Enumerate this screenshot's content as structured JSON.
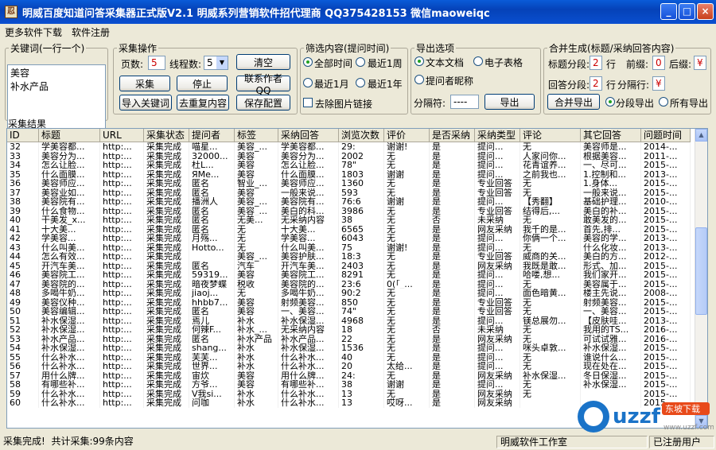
{
  "window": {
    "title": "明威百度知道问答采集器正式版V2.1 明威系列营销软件招代理商 QQ375428153 微信maoweiqc",
    "minimize": "_",
    "maximize": "□",
    "close": "×"
  },
  "menu": [
    "更多软件下载",
    "软件注册"
  ],
  "keywords": {
    "legend": "关键词(一行一个)",
    "lines": [
      "美容",
      "补水产品"
    ]
  },
  "collect": {
    "legend": "采集操作",
    "pages_label": "页数:",
    "pages_value": "5",
    "threads_label": "线程数:",
    "threads_value": "5",
    "clear": "清空",
    "collect": "采集",
    "stop": "停止",
    "contact": "联系作者QQ",
    "import": "导入关键词",
    "dedupe": "去重复内容",
    "save_config": "保存配置"
  },
  "filter": {
    "legend": "筛选内容(提问时间)",
    "all": "全部时间",
    "week": "最近1周",
    "month": "最近1月",
    "year": "最近1年",
    "remove_img": "去除图片链接"
  },
  "export": {
    "legend": "导出选项",
    "txt": "文本文档",
    "xls": "电子表格",
    "asker": "提问者昵称",
    "sep_label": "分隔符:",
    "sep_value": "----",
    "export_btn": "导出"
  },
  "merge": {
    "legend": "合并生成(标题/采纳回答内容)",
    "title_seg": "标题分段:",
    "title_seg_val": "2",
    "title_unit": "行",
    "prefix": "前缀:",
    "prefix_val": "0",
    "suffix": "后缀:",
    "suffix_val": "¥",
    "ans_seg": "回答分段:",
    "ans_seg_val": "2",
    "ans_unit": "行",
    "sepline": "分隔行:",
    "sepline_val": "¥",
    "merge_btn": "合并导出",
    "seg_export": "分段导出",
    "all_export": "所有导出"
  },
  "results": {
    "legend": "采集结果",
    "columns": [
      "ID",
      "标题",
      "URL",
      "采集状态",
      "提问者",
      "标签",
      "采纳回答",
      "浏览次数",
      "评价",
      "是否采纳",
      "采纳类型",
      "评论",
      "其它回答",
      "问题时间"
    ],
    "rows": [
      [
        "32",
        "学美容都...",
        "http:...",
        "采集完成",
        "喵星...",
        "美容_...",
        "学美容都...",
        "29:",
        "谢谢!",
        "是",
        "提问...",
        "无",
        "美容师是...",
        "2014-..."
      ],
      [
        "33",
        "美容分为...",
        "http:...",
        "采集完成",
        "32000...",
        "美容",
        "美容分为...",
        "2002",
        "无",
        "是",
        "提问...",
        "人家问你...",
        "根据美容...",
        "2011-..."
      ],
      [
        "34",
        "怎么让脸...",
        "http:...",
        "采集完成",
        "杜L...",
        "美容",
        "怎么让脸...",
        "78\"",
        "无",
        "是",
        "提问...",
        "花青谊养...",
        "一、尽可...",
        "2015-..."
      ],
      [
        "35",
        "什么面膜...",
        "http:...",
        "采集完成",
        "ЯMe...",
        "美容",
        "什么面膜...",
        "1803",
        "谢谢",
        "是",
        "提问...",
        "之前我也...",
        "1.控制和...",
        "2013-..."
      ],
      [
        "36",
        "美容师应...",
        "http:...",
        "采集完成",
        "匿名",
        "智业_...",
        "美容师应...",
        "1360",
        "无",
        "是",
        "专业回答",
        "无",
        "1.身体...",
        "2015-..."
      ],
      [
        "37",
        "美容业如...",
        "http:...",
        "采集完成",
        "匿名",
        "美容",
        "一般来说...",
        "593",
        "无",
        "是",
        "专业回答",
        "无",
        "一般来说...",
        "2015-..."
      ],
      [
        "38",
        "美容院有...",
        "http:...",
        "采集完成",
        "播洲人",
        "美容_...",
        "美容院有...",
        "76:6",
        "谢谢",
        "是",
        "提问...",
        "【秀翻】",
        "基础护理...",
        "2010-..."
      ],
      [
        "39",
        "什么食物...",
        "http:...",
        "采集完成",
        "匿名",
        "美容_...",
        "美白的科...",
        "3986",
        "无",
        "是",
        "专业回答",
        "结得后,...",
        "美白的补...",
        "2015-..."
      ],
      [
        "40",
        "干美发_x...",
        "http:...",
        "采集完成",
        "匿名",
        "无美...",
        "无采纳内容",
        "38",
        "无",
        "否",
        "未采纳",
        "无",
        "敢美发的...",
        "2015-..."
      ],
      [
        "41",
        "十大美...",
        "http:...",
        "采集完成",
        "匿名",
        "无",
        "十大美...",
        "6565",
        "无",
        "是",
        "网友采纳",
        "我千的是...",
        "首先,排...",
        "2015-..."
      ],
      [
        "42",
        "学美容...",
        "http:...",
        "采集完成",
        "月殇...",
        "无",
        "学美容...",
        "6043",
        "无",
        "是",
        "提问...",
        "你俩一个...",
        "美容的学...",
        "2013-..."
      ],
      [
        "43",
        "什么叫美...",
        "http:...",
        "采集完成",
        "Hotto...",
        "无",
        "什么叫美...",
        "75",
        "谢谢!",
        "是",
        "提问...",
        "无",
        "什么化妆...",
        "2013-..."
      ],
      [
        "44",
        "怎么有效...",
        "http:...",
        "采集完成",
        "",
        "美容_...",
        "美容护肤...",
        "18:3",
        "无",
        "是",
        "专业回答",
        "威商的关...",
        "美白的方...",
        "2012-..."
      ],
      [
        "45",
        "开汽车美...",
        "http:...",
        "采集完成",
        "匿名",
        "汽车",
        "开汽车美...",
        "2403",
        "无",
        "是",
        "网友采纳",
        "我既是敢...",
        "形式、加...",
        "2015-..."
      ],
      [
        "46",
        "美容院工...",
        "http:...",
        "采集完成",
        "59319...",
        "美容",
        "美容院工...",
        "8291",
        "无",
        "是",
        "提问...",
        "哈喽,想...",
        "我们家开...",
        "2015-..."
      ],
      [
        "47",
        "美容院的...",
        "http:...",
        "采集完成",
        "暗夜梦蝶",
        "税收",
        "美容院的...",
        "23:6",
        "0(「_...",
        "是",
        "提问...",
        "无",
        "美容属于...",
        "2015-..."
      ],
      [
        "48",
        "多喝牛奶...",
        "http:...",
        "采集完成",
        "jiaoj...",
        "无",
        "多喝牛奶...",
        "90:2",
        "无",
        "是",
        "提问...",
        "面色暗黄...",
        "楼主先说...",
        "2008-..."
      ],
      [
        "49",
        "美容仪种...",
        "http:...",
        "采集完成",
        "hhbb7...",
        "美容",
        "射频美容...",
        "850",
        "无",
        "是",
        "专业回答",
        "无",
        "射频美容...",
        "2015-..."
      ],
      [
        "50",
        "美容编辑...",
        "http:...",
        "采集完成",
        "匿名",
        "美容",
        "一、美容...",
        "74\"",
        "无",
        "是",
        "专业回答",
        "无",
        "一、美容...",
        "2015-..."
      ],
      [
        "51",
        "补水保湿...",
        "http:...",
        "采集完成",
        "焉儿",
        "补水",
        "补水保湿...",
        "4968",
        "无",
        "是",
        "提问...",
        "镁总展勿...",
        "【皮肤哇...",
        "2013-..."
      ],
      [
        "52",
        "补水保湿...",
        "http:...",
        "采集完成",
        "何辣F...",
        "补水_...",
        "无采纳内容",
        "18",
        "无",
        "否",
        "未采纳",
        "无",
        "我用的TS...",
        "2016-..."
      ],
      [
        "53",
        "补水产品...",
        "http:...",
        "采集完成",
        "匿名",
        "补水产品",
        "补水产品...",
        "22",
        "无",
        "是",
        "网友采纳",
        "无",
        "可试试雅...",
        "2016-..."
      ],
      [
        "54",
        "补水保湿...",
        "http:...",
        "采集完成",
        "shang...",
        "补水",
        "补水保湿...",
        "1536",
        "无",
        "是",
        "提问...",
        "咪头卓敦...",
        "补水保湿...",
        "2015-..."
      ],
      [
        "55",
        "什么补水...",
        "http:...",
        "采集完成",
        "芙芙...",
        "补水",
        "什么补水...",
        "40",
        "无",
        "是",
        "提问...",
        "无",
        "谁说什么...",
        "2015-..."
      ],
      [
        "56",
        "什么补水...",
        "http:...",
        "采集完成",
        "世界...",
        "补水",
        "什么补水...",
        "20",
        "太给...",
        "是",
        "提问...",
        "无",
        "现在处在...",
        "2015-..."
      ],
      [
        "57",
        "用什么牌...",
        "http:...",
        "采集完成",
        "宙炊",
        "美容",
        "用什么牌...",
        "24:",
        "无",
        "是",
        "网友采纳",
        "补水保湿...",
        "冬日保湿...",
        "2015-..."
      ],
      [
        "58",
        "有哪些补...",
        "http:...",
        "采集完成",
        "方爷...",
        "美容",
        "有哪些补...",
        "38",
        "谢谢",
        "是",
        "提问...",
        "无",
        "补水保湿...",
        "2015-..."
      ],
      [
        "59",
        "什么补水...",
        "http:...",
        "采集完成",
        "V我si...",
        "补水",
        "什么补水...",
        "13",
        "无",
        "是",
        "网友采纳",
        "无",
        "",
        "2015-..."
      ],
      [
        "60",
        "什么补水...",
        "http:...",
        "采集完成",
        "问咖",
        "补水",
        "什么补水...",
        "13",
        "哎呀...",
        "是",
        "网友采纳",
        "",
        "",
        "2015-..."
      ]
    ]
  },
  "status": {
    "done": "采集完成!",
    "count": "共计采集:99条内容",
    "studio": "明威软件工作室",
    "registered": "已注册用户"
  },
  "watermark": {
    "brand": "uzzf",
    "sub": "东坡下载",
    "site": "www.uzzf.com"
  }
}
